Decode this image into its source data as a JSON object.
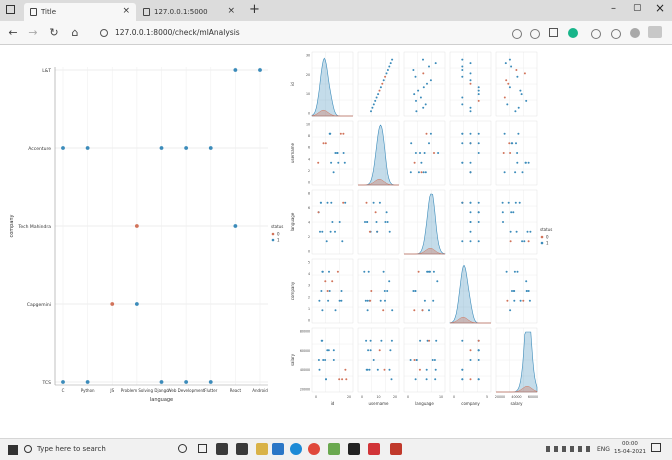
{
  "browser": {
    "tabs": [
      {
        "label": "Title",
        "active": true
      },
      {
        "label": "127.0.0.1:5000",
        "active": false
      }
    ],
    "new_tab_glyph": "+",
    "tab_close_glyph": "×",
    "url": "127.0.0.1:8000/check/mlAnalysis",
    "window_controls": {
      "minimize": "–",
      "maximize": "▢",
      "close": "×"
    },
    "nav_glyphs": {
      "back": "←",
      "forward": "→",
      "reload": "↻",
      "home": "⌂"
    }
  },
  "chart_data": [
    {
      "type": "scatter",
      "title": "",
      "xlabel": "language",
      "ylabel": "company",
      "x_categories": [
        "C",
        "Python",
        "JS",
        "Problem Solving",
        "Django",
        "Web Development",
        "Flutter",
        "React",
        "Android"
      ],
      "y_categories": [
        "L&T",
        "Accenture",
        "Tech Mahindra",
        "Capgemini",
        "TCS"
      ],
      "legend": {
        "title": "status",
        "entries": [
          "0",
          "1"
        ],
        "placement": "right"
      },
      "series": [
        {
          "name": "0",
          "color": "#d1735a",
          "points": [
            {
              "x": "JS",
              "y": "Capgemini"
            },
            {
              "x": "Problem Solving",
              "y": "Tech Mahindra"
            }
          ]
        },
        {
          "name": "1",
          "color": "#3b8bba",
          "points": [
            {
              "x": "React",
              "y": "L&T"
            },
            {
              "x": "Android",
              "y": "L&T"
            },
            {
              "x": "C",
              "y": "Accenture"
            },
            {
              "x": "Python",
              "y": "Accenture"
            },
            {
              "x": "Django",
              "y": "Accenture"
            },
            {
              "x": "Web Development",
              "y": "Accenture"
            },
            {
              "x": "Flutter",
              "y": "Accenture"
            },
            {
              "x": "React",
              "y": "Tech Mahindra"
            },
            {
              "x": "Problem Solving",
              "y": "Capgemini"
            },
            {
              "x": "C",
              "y": "TCS"
            },
            {
              "x": "Python",
              "y": "TCS"
            },
            {
              "x": "Django",
              "y": "TCS"
            },
            {
              "x": "Web Development",
              "y": "TCS"
            },
            {
              "x": "Flutter",
              "y": "TCS"
            }
          ]
        }
      ],
      "grid": true
    },
    {
      "type": "scatter",
      "subtype": "pairplot",
      "variables": [
        "id",
        "username",
        "language",
        "company",
        "salary"
      ],
      "axis_labels": [
        "id",
        "username",
        "language",
        "company",
        "salary"
      ],
      "ticks": {
        "x": [
          [
            "0",
            "20"
          ],
          [
            "0",
            "10",
            "20"
          ],
          [
            "0",
            "10"
          ],
          [
            "0",
            "5"
          ],
          [
            "20000",
            "40000",
            "60000"
          ]
        ],
        "y": [
          [
            "0",
            "10",
            "20",
            "30"
          ],
          [
            "0",
            "2",
            "4",
            "6",
            "8",
            "10"
          ],
          [
            "0",
            "2",
            "4",
            "6",
            "8"
          ],
          [
            "0",
            "1",
            "2",
            "3",
            "4",
            "5"
          ],
          [
            "20000",
            "40000",
            "60000",
            "80000"
          ]
        ]
      },
      "hue": {
        "title": "status",
        "entries": [
          "0",
          "1"
        ],
        "colors": [
          "#d1735a",
          "#3b8bba"
        ],
        "placement": "right"
      },
      "diagonal": "kde",
      "grid": true
    }
  ],
  "taskbar": {
    "search_placeholder": "Type here to search",
    "tray_text": "ENG",
    "clock_time": "00:00",
    "clock_date": "15-04-2021"
  }
}
